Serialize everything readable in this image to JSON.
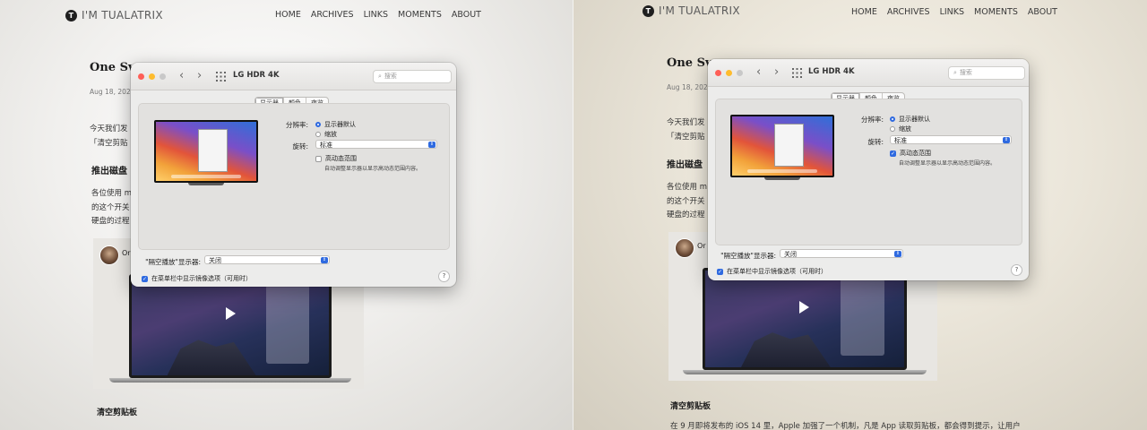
{
  "site": {
    "logo_letter": "T",
    "logo_text": "I'M TUALATRIX",
    "nav": [
      "HOME",
      "ARCHIVES",
      "LINKS",
      "MOMENTS",
      "ABOUT"
    ]
  },
  "post": {
    "title_left": "One Sv",
    "title_right": "One Sv",
    "date": "Aug 18, 2020",
    "intro_line1": "今天我们发",
    "intro_line2": "「清空剪贴",
    "section_eject": "推出磁盘",
    "body_line1": "各位使用 m",
    "body_line2": "的这个开关",
    "body_line3": "硬盘的过程",
    "video_title": "Or",
    "section_clipboard": "清空剪贴板",
    "clipboard_para": "在 9 月即将发布的 iOS 14 里，Apple 加强了一个机制，凡是 App 读取剪贴板，都会得到提示，让用户"
  },
  "window": {
    "title": "LG HDR 4K",
    "search_placeholder": "搜索",
    "tabs": [
      "显示器",
      "颜色",
      "夜览"
    ],
    "resolution_label": "分辨率:",
    "option_default": "显示器默认",
    "option_scaled": "缩放",
    "rotation_label": "旋转:",
    "rotation_value": "标准",
    "hdr_label": "高动态范围",
    "hdr_note": "自动调整显示器以显示高动态范围内容。",
    "airplay_label": "\"隔空播放\"显示器:",
    "airplay_value": "关闭",
    "mirror_label": "在菜单栏中显示镜像选项（可用时）",
    "help": "?"
  }
}
